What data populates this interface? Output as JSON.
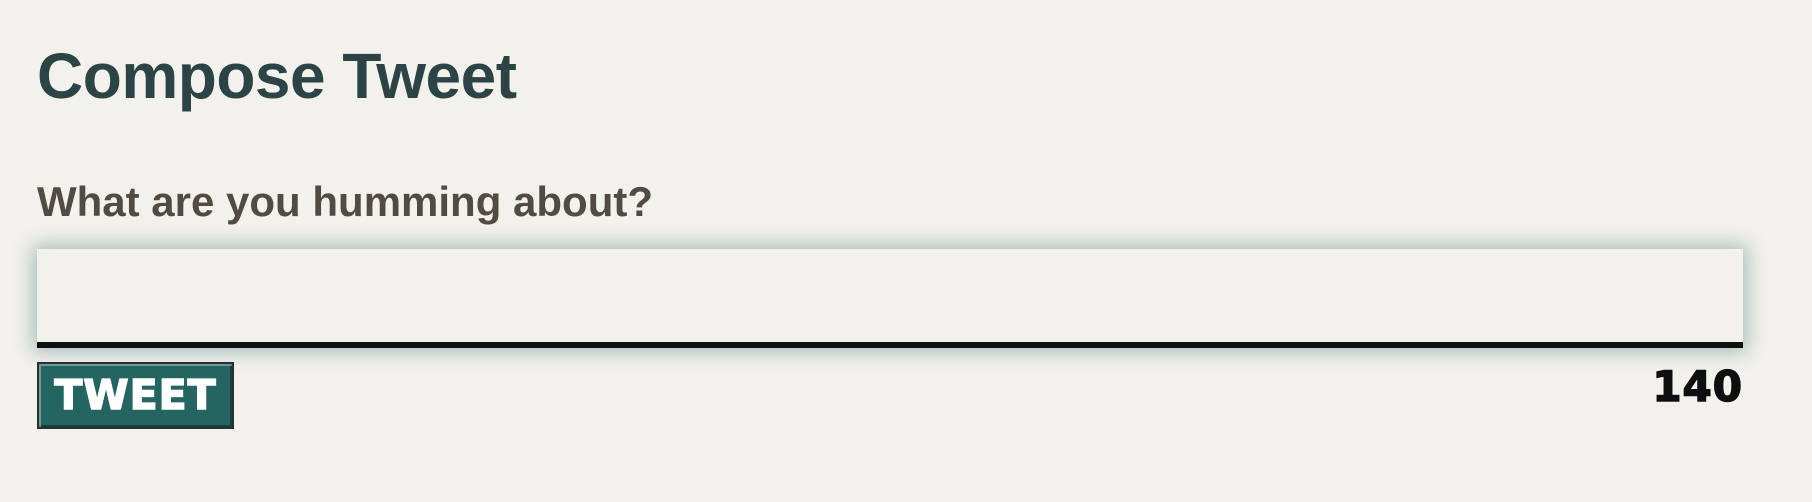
{
  "page": {
    "title": "Compose Tweet"
  },
  "compose": {
    "prompt_label": "What are you humming about?",
    "tweet_input": {
      "value": "",
      "placeholder": ""
    },
    "tweet_button_label": "TWEET",
    "remaining_characters": "140"
  },
  "colors": {
    "background": "#f3f1ec",
    "title_text": "#2c4446",
    "label_text": "#514b46",
    "button_background": "#246461",
    "input_underline": "#0d0f10",
    "input_glow": "#467d7d"
  }
}
